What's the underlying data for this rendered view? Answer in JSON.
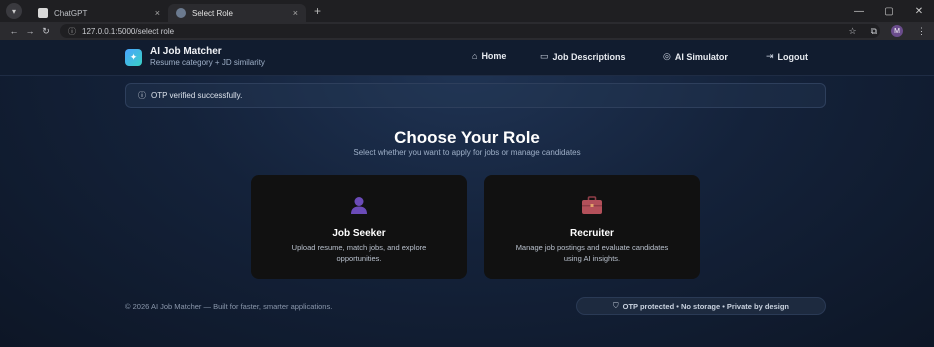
{
  "browser": {
    "tabs": [
      {
        "label": "ChatGPT",
        "close": "×"
      },
      {
        "label": "Select Role",
        "close": "×"
      }
    ],
    "new_tab": "+",
    "url": "127.0.0.1:5000/select role",
    "window_controls": [
      "—",
      "▢",
      "✕"
    ],
    "profile_initial": "M"
  },
  "nav": {
    "brand_title": "AI Job Matcher",
    "brand_subtitle": "Resume category + JD similarity",
    "items": [
      {
        "label": "Home",
        "icon": "home-icon"
      },
      {
        "label": "Job Descriptions",
        "icon": "document-icon"
      },
      {
        "label": "AI Simulator",
        "icon": "target-icon"
      },
      {
        "label": "Logout",
        "icon": "logout-icon"
      }
    ]
  },
  "alert": {
    "text": "OTP verified successfully."
  },
  "main": {
    "title": "Choose Your Role",
    "subtitle": "Select whether you want to apply for jobs or manage candidates",
    "cards": [
      {
        "title": "Job Seeker",
        "description": "Upload resume, match jobs, and explore opportunities.",
        "icon": "person-icon"
      },
      {
        "title": "Recruiter",
        "description": "Manage job postings and evaluate candidates using AI insights.",
        "icon": "briefcase-icon"
      }
    ]
  },
  "footer": {
    "copyright": "© 2026 AI Job Matcher — Built for faster, smarter applications.",
    "badge": "OTP protected • No storage • Private by design"
  },
  "colors": {
    "accent": "#4aa3ff",
    "seeker_icon": "#6b4bb8",
    "recruiter_icon": "#b3505a"
  }
}
